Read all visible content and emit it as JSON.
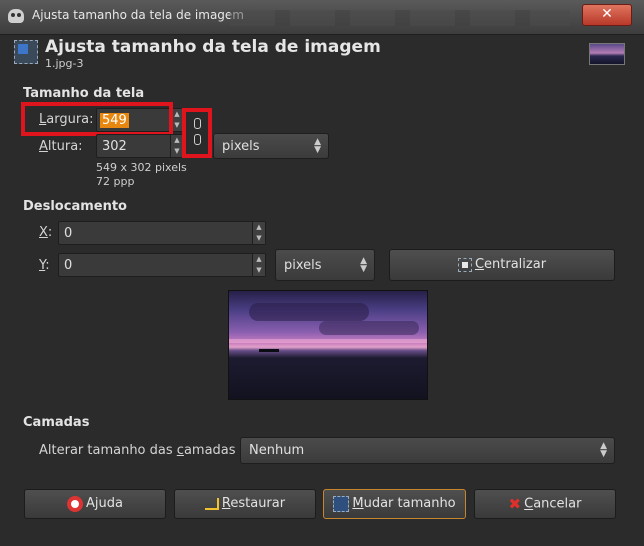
{
  "window": {
    "title": "Ajusta tamanho da tela de imagem",
    "close_label": "✕"
  },
  "header": {
    "title": "Ajusta tamanho da tela de imagem",
    "subtitle": "1.jpg-3"
  },
  "canvas_size": {
    "section_title": "Tamanho da tela",
    "width_label_u": "L",
    "width_label_rest": "argura:",
    "width_value": "549",
    "height_label_u": "A",
    "height_label_rest": "ltura:",
    "height_value": "302",
    "unit": "pixels",
    "info_size": "549 x 302 pixels",
    "info_res": "72 ppp"
  },
  "offset": {
    "section_title": "Deslocamento",
    "x_label_u": "X",
    "x_label_rest": ":",
    "x_value": "0",
    "y_label_u": "Y",
    "y_label_rest": ":",
    "y_value": "0",
    "unit": "pixels",
    "center_pre": "",
    "center_u": "C",
    "center_rest": "entralizar"
  },
  "layers": {
    "section_title": "Camadas",
    "resize_label_pre": "Alterar tamanho das ",
    "resize_label_u": "c",
    "resize_label_rest": "amadas",
    "resize_value": "Nenhum"
  },
  "buttons": {
    "help_pre": "A",
    "help_u": "j",
    "help_rest": "uda",
    "reset_u": "R",
    "reset_rest": "estaurar",
    "resize_u": "M",
    "resize_rest": "udar tamanho",
    "cancel_u": "C",
    "cancel_rest": "ancelar"
  },
  "colors": {
    "highlight_red": "#e0141c",
    "selection_orange": "#e8870f"
  }
}
